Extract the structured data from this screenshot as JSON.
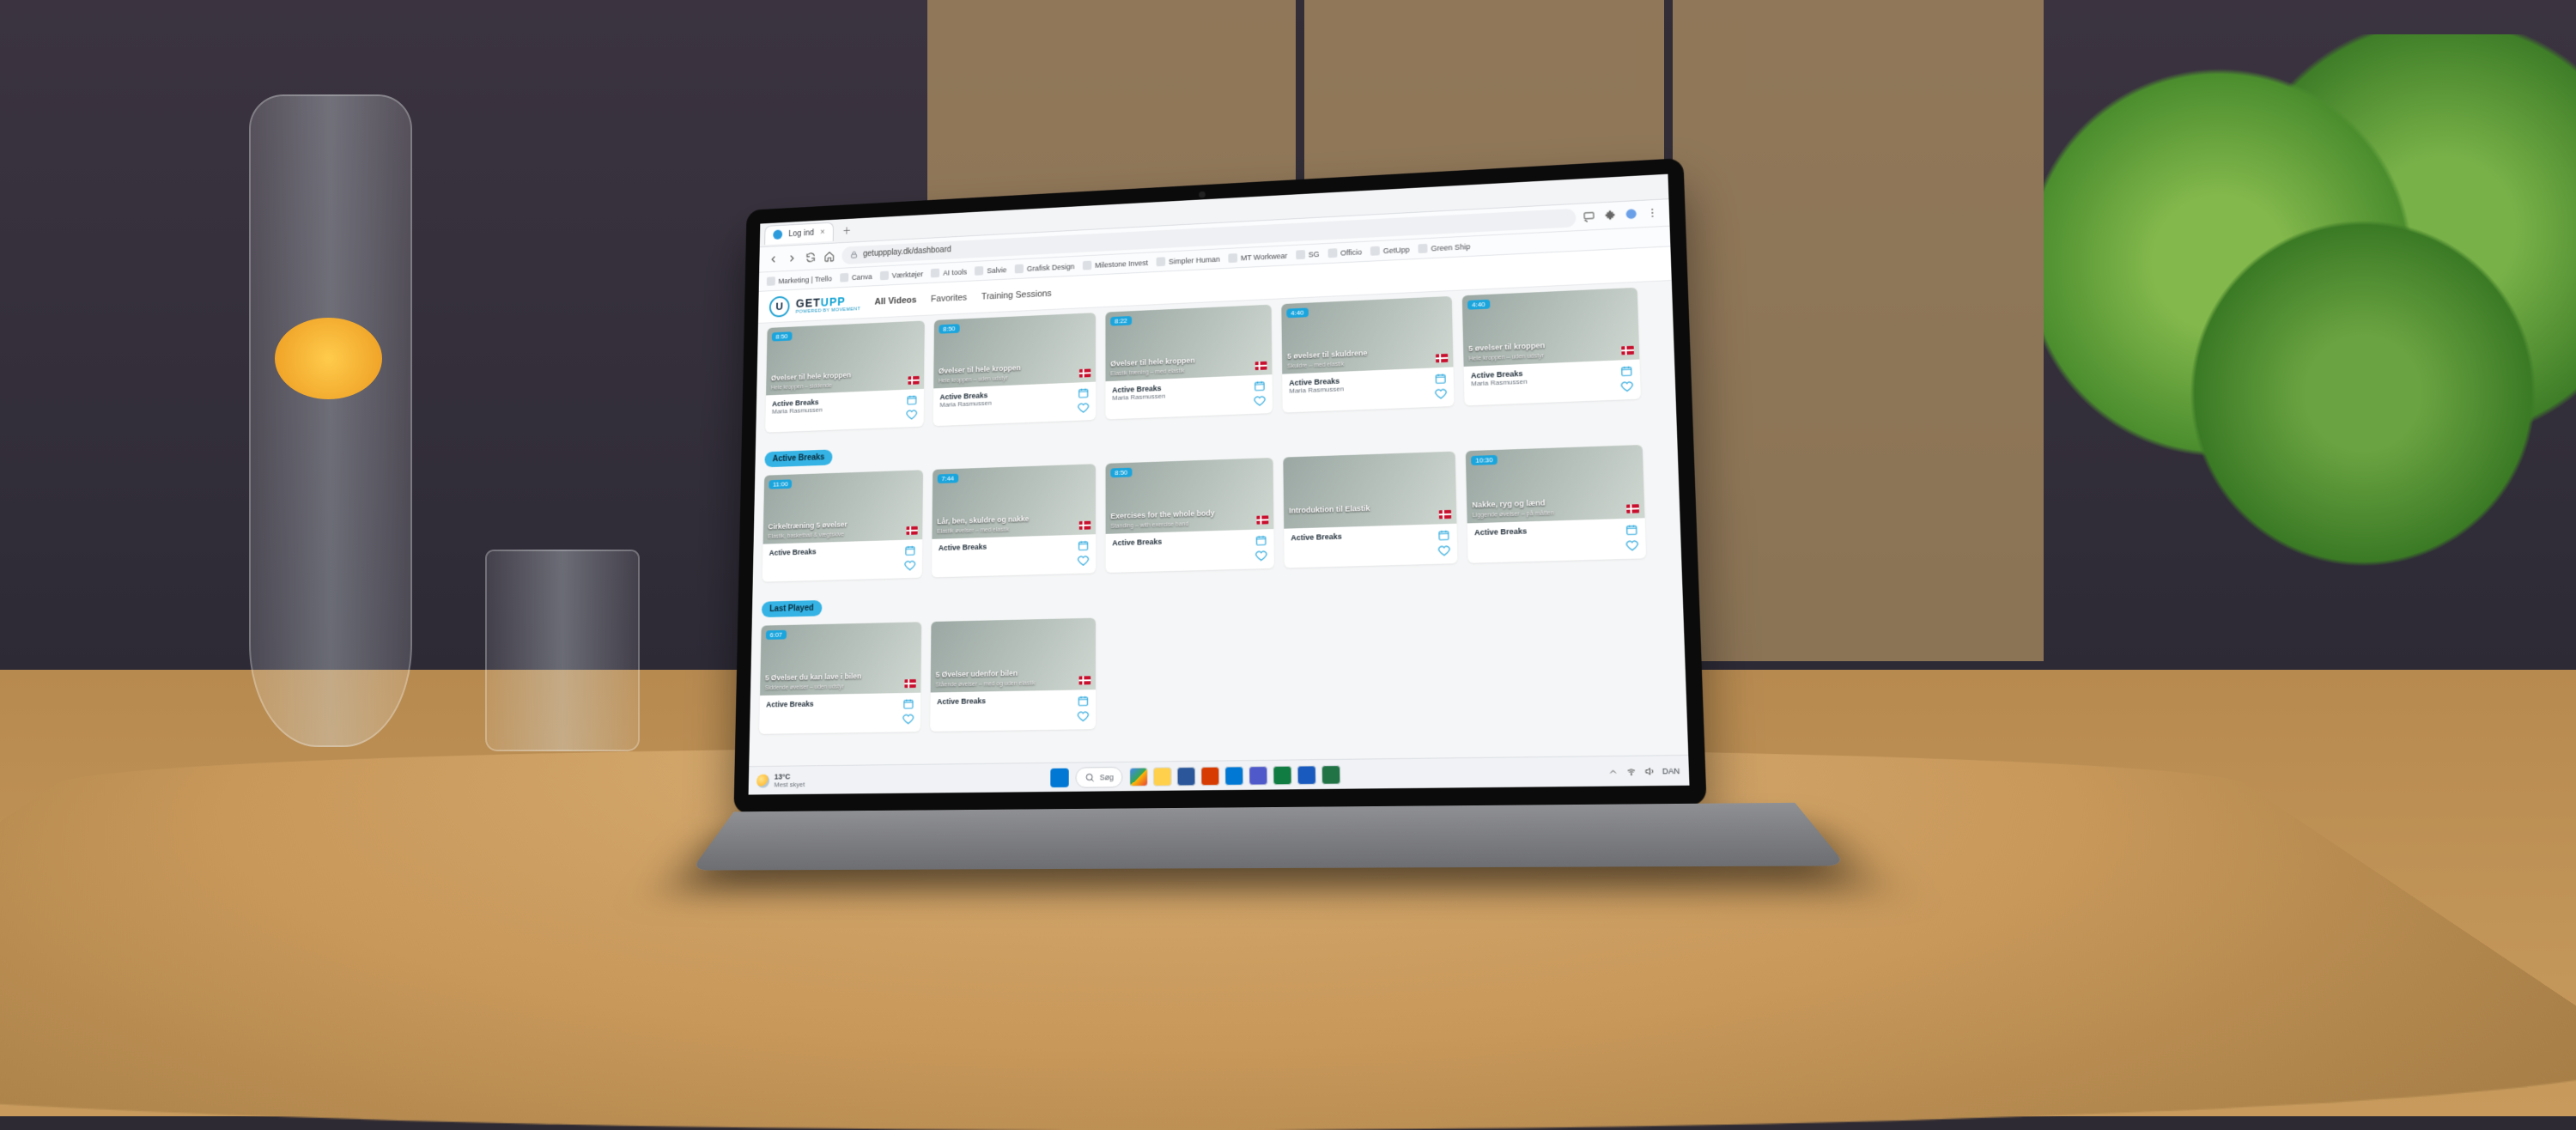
{
  "browser": {
    "tab_title": "Log ind",
    "url": "getuppplay.dk/dashboard",
    "bookmarks": [
      "Marketing | Trello",
      "Canva",
      "Værktøjer",
      "AI tools",
      "Salvie",
      "Grafisk Design",
      "Milestone Invest",
      "Simpler Human",
      "MT Workwear",
      "SG",
      "Officio",
      "GetUpp",
      "Green Ship"
    ]
  },
  "app": {
    "brand_top": "GET",
    "brand_accent": "UPP",
    "brand_sub": "POWERED BY MOVEMENT",
    "nav": {
      "all": "All Videos",
      "fav": "Favorites",
      "train": "Training Sessions"
    }
  },
  "sections": {
    "row1": {
      "cards": [
        {
          "dur": "8:50",
          "title": "Øvelser til hele kroppen",
          "sub": "Hele kroppen – siddende",
          "cat": "Active Breaks",
          "auth": "Maria Rasmussen"
        },
        {
          "dur": "8:50",
          "title": "Øvelser til hele kroppen",
          "sub": "Hele kroppen – uden udstyr",
          "cat": "Active Breaks",
          "auth": "Maria Rasmussen"
        },
        {
          "dur": "8:22",
          "title": "Øvelser til hele kroppen",
          "sub": "Elastik træning – med elastik",
          "cat": "Active Breaks",
          "auth": "Maria Rasmussen"
        },
        {
          "dur": "4:40",
          "title": "5 øvelser til skuldrene",
          "sub": "Skuldre – med elastik",
          "cat": "Active Breaks",
          "auth": "Maria Rasmussen"
        },
        {
          "dur": "4:40",
          "title": "5 øvelser til kroppen",
          "sub": "Hele kroppen – uden udstyr",
          "cat": "Active Breaks",
          "auth": "Maria Rasmussen"
        }
      ]
    },
    "row2": {
      "label": "Active Breaks",
      "cards": [
        {
          "dur": "11:00",
          "title": "Cirkeltræning 5 øvelser",
          "sub": "Elastik, basketball & vægtskive",
          "cat": "Active Breaks"
        },
        {
          "dur": "7:44",
          "title": "Lår, ben, skuldre og nakke",
          "sub": "Elastik øvelser – med elastik",
          "cat": "Active Breaks"
        },
        {
          "dur": "8:50",
          "title": "Exercises for the whole body",
          "sub": "Standing – with exercise band",
          "cat": "Active Breaks"
        },
        {
          "dur": "",
          "title": "Introduktion til Elastik",
          "sub": "",
          "cat": "Active Breaks"
        },
        {
          "dur": "10:30",
          "title": "Nakke, ryg og lænd",
          "sub": "Liggende øvelser – på måtten",
          "cat": "Active Breaks"
        }
      ]
    },
    "row3": {
      "label": "Last Played",
      "cards": [
        {
          "dur": "6:07",
          "title": "5 Øvelser du kan lave i bilen",
          "sub": "Siddende øvelser – uden udstyr",
          "cat": "Active Breaks"
        },
        {
          "dur": "",
          "title": "5 Øvelser udenfor bilen",
          "sub": "Stående øvelser – med og uden elastik",
          "cat": "Active Breaks"
        }
      ]
    }
  },
  "taskbar": {
    "temp": "13°C",
    "cond": "Mest skyet",
    "search": "Søg",
    "lang": "DAN"
  }
}
